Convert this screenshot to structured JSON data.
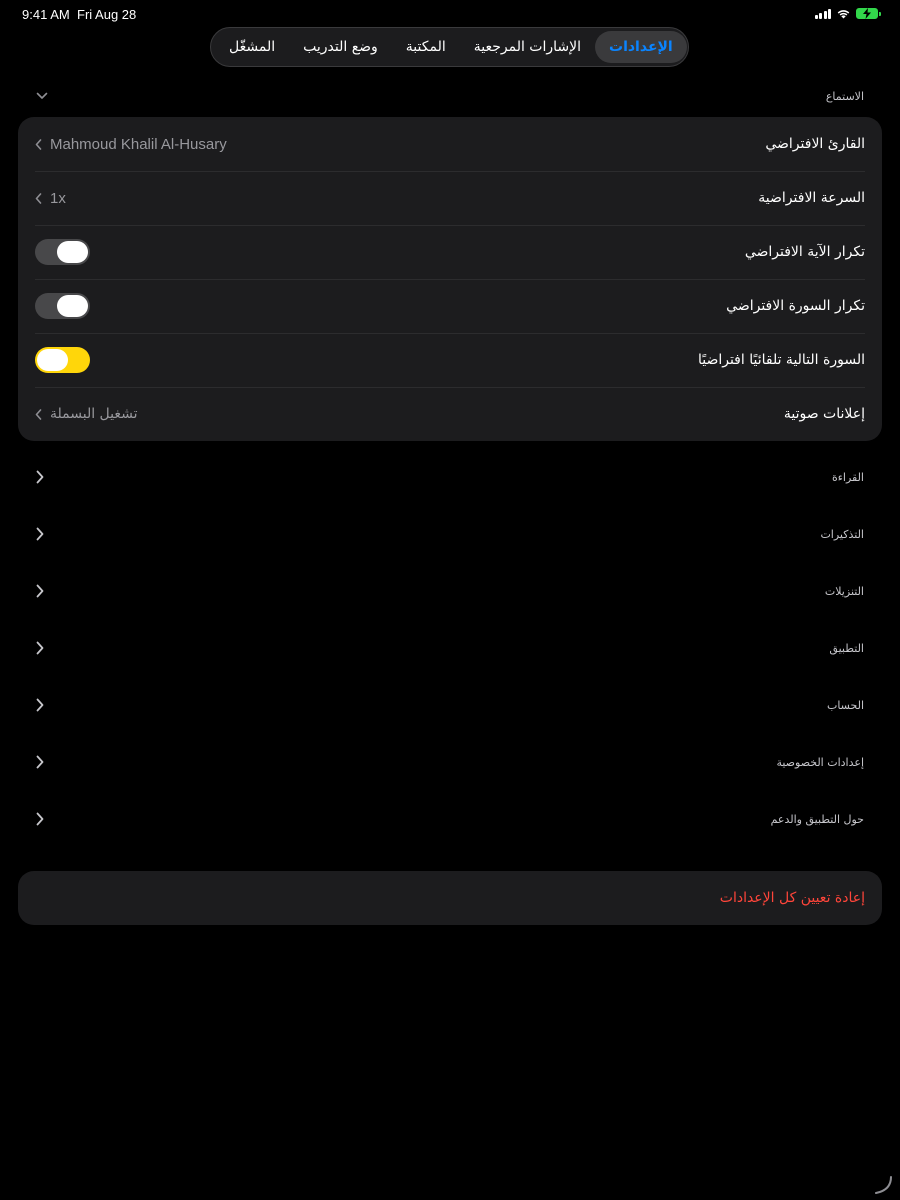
{
  "status_bar": {
    "time": "9:41 AM",
    "date": "Fri Aug 28",
    "battery_color": "#32d74b"
  },
  "tabs": [
    {
      "label": "المشغّل",
      "active": false
    },
    {
      "label": "وضع التدريب",
      "active": false
    },
    {
      "label": "المكتبة",
      "active": false
    },
    {
      "label": "الإشارات المرجعية",
      "active": false
    },
    {
      "label": "الإعدادات",
      "active": true
    }
  ],
  "listening": {
    "header": "الاستماع",
    "rows": {
      "reciter": {
        "label": "القارئ الافتراضي",
        "value": "Mahmoud Khalil Al-Husary"
      },
      "speed": {
        "label": "السرعة الافتراضية",
        "value": "1x"
      },
      "repeat_ayah": {
        "label": "تكرار الآية الافتراضي",
        "enabled": false
      },
      "repeat_surah": {
        "label": "تكرار السورة الافتراضي",
        "enabled": false
      },
      "autoplay_next": {
        "label": "السورة التالية تلقائيًا افتراضيًا",
        "enabled": true
      },
      "audio_announcements": {
        "label": "إعلانات صوتية",
        "value": "تشغيل البسملة"
      }
    }
  },
  "sections": {
    "reading": "القراءة",
    "reminders": "التذكيرات",
    "downloads": "التنزيلات",
    "app": "التطبيق",
    "account": "الحساب",
    "privacy": "إعدادات الخصوصية",
    "about": "حول التطبيق والدعم"
  },
  "reset": {
    "label": "إعادة تعيين كل الإعدادات",
    "color": "#ff453a"
  },
  "accent": {
    "active_tab": "#0a84ff",
    "toggle_on": "#ffd60a"
  }
}
